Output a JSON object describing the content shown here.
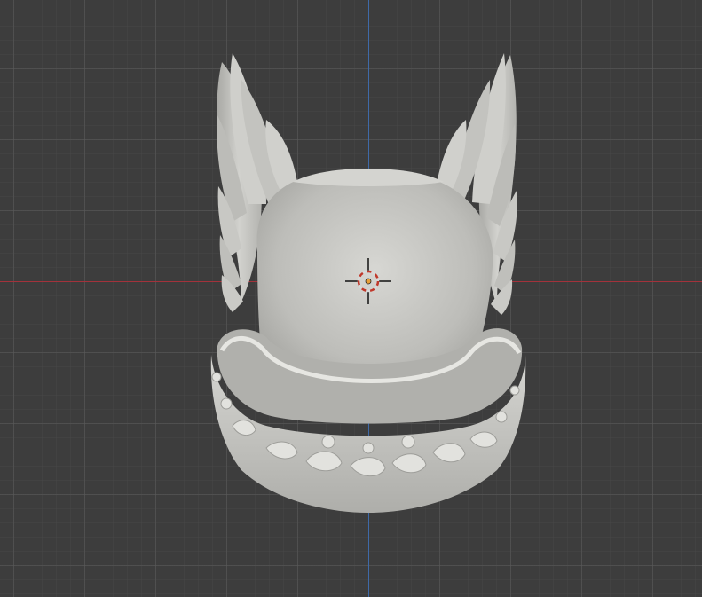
{
  "viewport": {
    "background_color": "#3d3d3d",
    "grid_color": "#4f4f4f"
  },
  "axes": {
    "x_axis_color": "#a3323b",
    "y_axis_color": "#3f6aa8"
  },
  "scene": {
    "object": "winged-ring-model",
    "object_color": "#c9c9c5",
    "shadow_color": "#8e8e8a"
  },
  "cursor": {
    "icon": "3d-cursor-icon",
    "ring_colors": [
      "#d9d9d9",
      "#c0392b"
    ],
    "center_color": "#e8a03a"
  }
}
